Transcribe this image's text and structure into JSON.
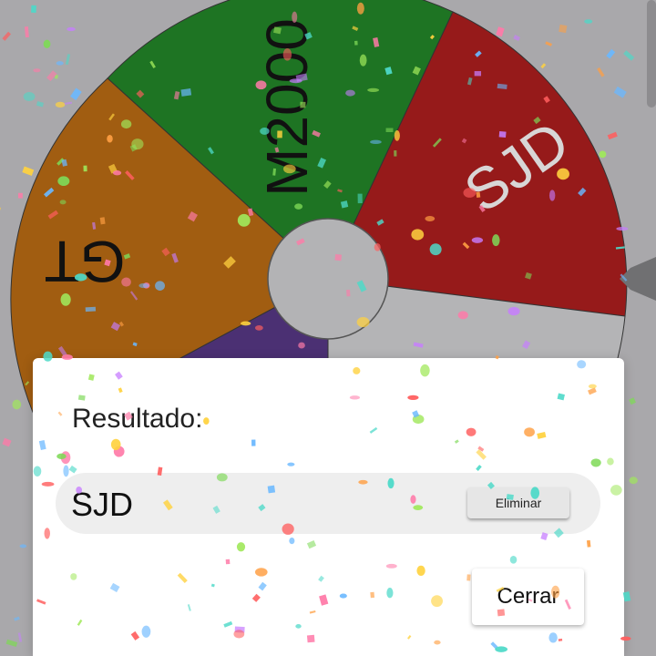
{
  "wheel": {
    "segments": [
      {
        "label": "M2000",
        "color": "#1e7423"
      },
      {
        "label": "SJD",
        "color": "#961a1a"
      },
      {
        "label": "",
        "color": "#b4b4b6"
      },
      {
        "label": "",
        "color": "#4b3073"
      },
      {
        "label": "GT",
        "color": "#a15d11"
      }
    ],
    "hub_color": "#b3b3b5"
  },
  "dialog": {
    "title": "Resultado:",
    "result": "SJD",
    "remove_label": "Eliminar",
    "close_label": "Cerrar"
  },
  "colors": {
    "backdrop": "#a9a8ab",
    "dialog_background": "#ffffff",
    "result_row_background": "#eeeeee"
  },
  "icons": [
    "pointer-arrow-icon"
  ],
  "confetti_palette": [
    "#ff7aa8",
    "#7ed957",
    "#6ab8ff",
    "#ffd23f",
    "#c77dff",
    "#ff9f43",
    "#4dd9c8",
    "#ff5e5e",
    "#a0e85b"
  ]
}
